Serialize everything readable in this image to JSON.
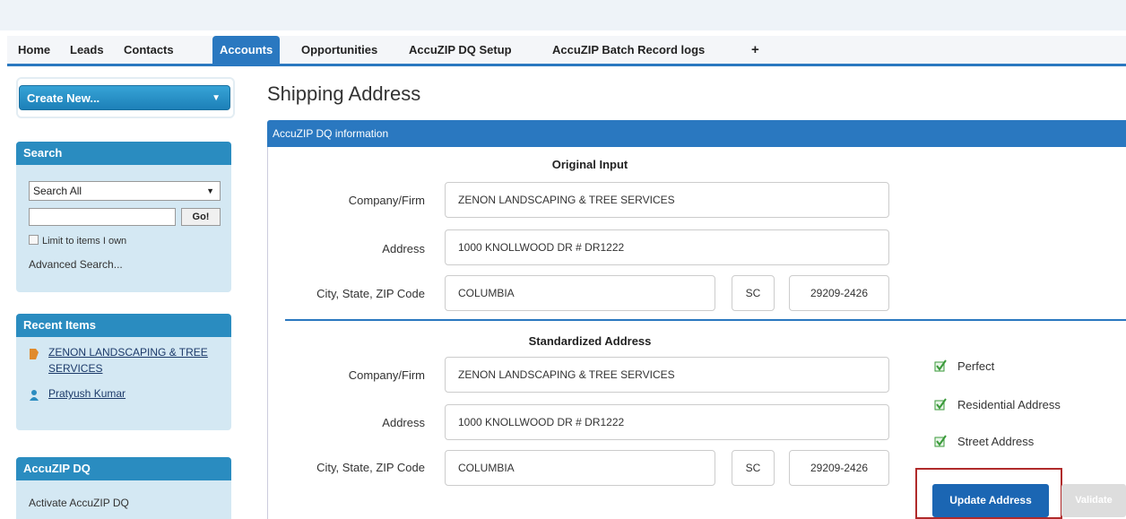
{
  "nav": {
    "tabs": [
      "Home",
      "Leads",
      "Contacts",
      "Accounts",
      "Opportunities",
      "AccuZIP DQ Setup",
      "AccuZIP Batch Record logs",
      "+"
    ],
    "active_tab": "Accounts"
  },
  "sidebar": {
    "create_new": "Create New...",
    "search": {
      "title": "Search",
      "scope": "Search All",
      "query": "",
      "go": "Go!",
      "limit_label": "Limit to items I own",
      "advanced": "Advanced Search..."
    },
    "recent": {
      "title": "Recent Items",
      "items": [
        "ZENON LANDSCAPING & TREE SERVICES",
        "Pratyush Kumar"
      ]
    },
    "accuzip": {
      "title": "AccuZIP DQ",
      "link": "Activate AccuZIP DQ"
    }
  },
  "main": {
    "page_title": "Shipping Address",
    "section_title": "AccuZIP DQ information",
    "original": {
      "title": "Original Input",
      "company_label": "Company/Firm",
      "company": "ZENON LANDSCAPING & TREE SERVICES",
      "address_label": "Address",
      "address": "1000 KNOLLWOOD DR # DR1222",
      "csz_label": "City, State, ZIP Code",
      "city": "COLUMBIA",
      "state": "SC",
      "zip": "29209-2426"
    },
    "standardized": {
      "title": "Standardized Address",
      "company_label": "Company/Firm",
      "company": "ZENON LANDSCAPING & TREE SERVICES",
      "address_label": "Address",
      "address": "1000 KNOLLWOOD DR # DR1222",
      "csz_label": "City, State, ZIP Code",
      "city": "COLUMBIA",
      "state": "SC",
      "zip": "29209-2426"
    },
    "status_flags": [
      "Perfect",
      "Residential Address",
      "Street Address"
    ],
    "update_button": "Update Address",
    "validate_button": "Validate"
  },
  "colors": {
    "accent": "#2a78c0",
    "highlight": "#b02a2a",
    "check": "#3a9a3a"
  }
}
